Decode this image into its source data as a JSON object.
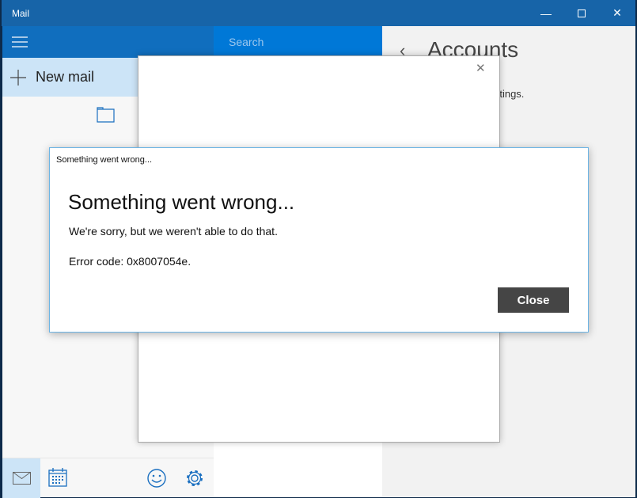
{
  "window": {
    "title": "Mail",
    "minimize_icon": "minimize-icon",
    "maximize_icon": "maximize-icon",
    "close_icon": "close-icon"
  },
  "sidebar": {
    "new_mail_label": "New mail"
  },
  "search": {
    "placeholder": "Search"
  },
  "accounts": {
    "title": "Accounts",
    "partial_text": "lit settings."
  },
  "colors": {
    "titlebar": "#1764a8",
    "accent": "#0078d7",
    "button": "#454545"
  },
  "error_dialog": {
    "window_title": "Something went wrong...",
    "heading": "Something went wrong...",
    "message": "We're sorry, but we weren't able to do that.",
    "error_code": "Error code: 0x8007054e.",
    "close_label": "Close"
  }
}
